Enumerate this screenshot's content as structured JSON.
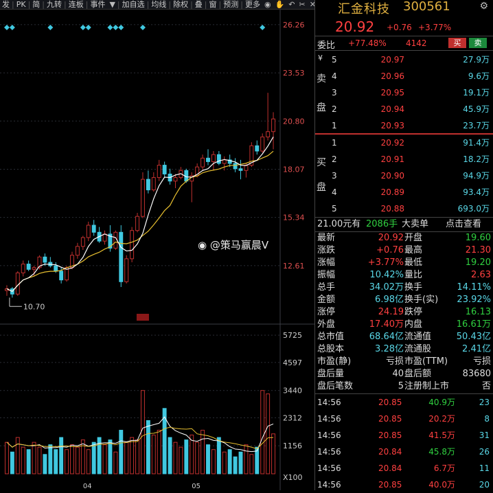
{
  "toolbar": {
    "items": [
      "发",
      "PK",
      "简",
      "九转",
      "连板",
      "事件"
    ],
    "dropdown_icon": "caret-down-icon",
    "items2": [
      "加自选",
      "均线",
      "除权",
      "叠",
      "窗",
      "预测",
      "更多"
    ],
    "icons": [
      "eye-icon",
      "hand-icon",
      "undo-icon",
      "scissors-icon",
      "close-icon",
      "up-icon",
      "down-icon"
    ]
  },
  "chart": {
    "price_axis": [
      "26.26",
      "23.53",
      "20.80",
      "18.07",
      "15.34",
      "12.61"
    ],
    "low_marker": "10.70",
    "vol_axis": [
      "5725",
      "4597",
      "3440",
      "2312",
      "1156"
    ],
    "vol_scale": "X100",
    "months": [
      "04",
      "05"
    ],
    "colors": {
      "up": "#c0302e",
      "down": "#40c8e0",
      "ma5": "#ffffff",
      "ma10": "#e8c030",
      "diamond": "#40c8e0",
      "grid": "#2a2d35"
    }
  },
  "chart_data": {
    "type": "candlestick",
    "candles": [
      [
        11.2,
        11.5,
        10.9,
        11.3
      ],
      [
        11.3,
        11.4,
        10.8,
        11.0
      ],
      [
        11.0,
        12.3,
        10.9,
        12.2
      ],
      [
        12.2,
        12.9,
        12.0,
        12.7
      ],
      [
        12.7,
        12.9,
        12.3,
        12.4
      ],
      [
        12.4,
        12.6,
        12.0,
        12.5
      ],
      [
        12.5,
        13.2,
        12.4,
        13.1
      ],
      [
        13.1,
        13.3,
        12.6,
        12.8
      ],
      [
        12.8,
        13.1,
        12.5,
        12.6
      ],
      [
        12.6,
        12.8,
        12.2,
        12.3
      ],
      [
        12.3,
        12.5,
        11.6,
        11.8
      ],
      [
        11.8,
        12.6,
        11.7,
        12.5
      ],
      [
        12.5,
        13.4,
        12.4,
        13.2
      ],
      [
        13.2,
        13.9,
        13.0,
        13.7
      ],
      [
        13.7,
        14.3,
        13.5,
        14.2
      ],
      [
        14.2,
        15.1,
        14.0,
        14.9
      ],
      [
        14.9,
        15.2,
        14.3,
        14.5
      ],
      [
        14.5,
        14.8,
        13.9,
        14.0
      ],
      [
        14.0,
        14.6,
        13.8,
        14.4
      ],
      [
        14.4,
        14.9,
        13.4,
        13.6
      ],
      [
        13.6,
        14.6,
        13.5,
        14.5
      ],
      [
        14.5,
        14.9,
        11.4,
        11.7
      ],
      [
        11.7,
        13.2,
        11.6,
        13.0
      ],
      [
        13.0,
        14.8,
        12.8,
        14.6
      ],
      [
        14.6,
        15.6,
        14.5,
        15.4
      ],
      [
        15.4,
        17.9,
        15.3,
        17.5
      ],
      [
        17.5,
        18.0,
        16.7,
        16.9
      ],
      [
        16.9,
        17.9,
        16.8,
        17.6
      ],
      [
        17.6,
        18.6,
        17.4,
        18.3
      ],
      [
        18.3,
        18.5,
        17.6,
        17.8
      ],
      [
        17.8,
        18.1,
        17.2,
        17.4
      ],
      [
        17.4,
        17.8,
        17.0,
        17.6
      ],
      [
        17.6,
        18.2,
        17.5,
        18.0
      ],
      [
        18.0,
        18.1,
        17.3,
        17.4
      ],
      [
        17.4,
        17.9,
        16.2,
        17.7
      ],
      [
        17.7,
        18.4,
        17.6,
        18.2
      ],
      [
        18.2,
        18.9,
        18.0,
        18.7
      ],
      [
        18.7,
        19.2,
        18.3,
        18.5
      ],
      [
        18.5,
        19.1,
        18.0,
        18.9
      ],
      [
        18.9,
        19.1,
        18.3,
        18.4
      ],
      [
        18.4,
        18.8,
        18.0,
        18.6
      ],
      [
        18.6,
        18.9,
        18.2,
        18.4
      ],
      [
        18.4,
        18.7,
        17.9,
        18.1
      ],
      [
        18.1,
        18.6,
        17.5,
        18.0
      ],
      [
        18.0,
        18.4,
        17.6,
        18.3
      ],
      [
        18.3,
        19.6,
        18.2,
        19.4
      ],
      [
        19.4,
        19.7,
        18.9,
        19.1
      ],
      [
        19.1,
        20.1,
        19.0,
        19.9
      ],
      [
        19.9,
        22.4,
        19.7,
        20.2
      ],
      [
        20.2,
        21.3,
        19.2,
        20.92
      ]
    ],
    "volumes": [
      1300,
      900,
      1500,
      1100,
      1000,
      1300,
      1100,
      800,
      1200,
      1000,
      1500,
      1000,
      1200,
      1100,
      1400,
      1000,
      1300,
      1500,
      1200,
      1400,
      900,
      1800,
      1300,
      1500,
      1400,
      3440,
      2200,
      1600,
      1800,
      2700,
      1500,
      1300,
      1100,
      1400,
      1600,
      1300,
      1800,
      1200,
      1000,
      1500,
      900,
      1000,
      700,
      900,
      1200,
      800,
      1100,
      3440,
      3300,
      1650
    ]
  },
  "panel": {
    "name": "汇金科技",
    "code": "300561",
    "settings_icon": "gear-icon",
    "price": "20.92",
    "change": "+0.76",
    "change_pct": "+3.77%",
    "weibi_label": "委比",
    "weibi_value": "+77.48%",
    "weicha": "4142",
    "buy_btn": "买",
    "sell_btn": "卖",
    "yen": "¥",
    "sell_side": [
      "卖",
      "盘"
    ],
    "buy_side": [
      "买",
      "盘"
    ],
    "sell": [
      {
        "lvl": "5",
        "price": "20.97",
        "vol": "27.9万"
      },
      {
        "lvl": "4",
        "price": "20.96",
        "vol": "9.6万"
      },
      {
        "lvl": "3",
        "price": "20.95",
        "vol": "19.1万"
      },
      {
        "lvl": "2",
        "price": "20.94",
        "vol": "45.9万"
      },
      {
        "lvl": "1",
        "price": "20.93",
        "vol": "23.7万"
      }
    ],
    "buy": [
      {
        "lvl": "1",
        "price": "20.92",
        "vol": "91.4万"
      },
      {
        "lvl": "2",
        "price": "20.91",
        "vol": "18.2万"
      },
      {
        "lvl": "3",
        "price": "20.90",
        "vol": "94.9万"
      },
      {
        "lvl": "4",
        "price": "20.89",
        "vol": "93.4万"
      },
      {
        "lvl": "5",
        "price": "20.88",
        "vol": "693.0万"
      }
    ],
    "bigorder": {
      "price": "21.00元有",
      "qty": "2086手",
      "label": "大卖单",
      "link": "点击查看"
    },
    "stats": [
      [
        "最新",
        "20.92",
        "red",
        "开盘",
        "19.60",
        "green"
      ],
      [
        "涨跌",
        "+0.76",
        "red",
        "最高",
        "21.30",
        "red"
      ],
      [
        "涨幅",
        "+3.77%",
        "red",
        "最低",
        "19.20",
        "green"
      ],
      [
        "振幅",
        "10.42%",
        "cyan",
        "量比",
        "2.63",
        "red"
      ],
      [
        "总手",
        "34.02万",
        "cyan",
        "换手",
        "14.11%",
        "cyan"
      ],
      [
        "金额",
        "6.98亿",
        "cyan",
        "换手(实)",
        "23.92%",
        "cyan"
      ],
      [
        "涨停",
        "24.19",
        "red",
        "跌停",
        "16.13",
        "green"
      ],
      [
        "外盘",
        "17.40万",
        "red",
        "内盘",
        "16.61万",
        "green"
      ],
      [
        "总市值",
        "68.64亿",
        "cyan",
        "流通值",
        "50.43亿",
        "cyan"
      ],
      [
        "总股本",
        "3.28亿",
        "cyan",
        "流通股",
        "2.41亿",
        "cyan"
      ],
      [
        "市盈(静)",
        "亏损",
        "white",
        "市盈(TTM)",
        "亏损",
        "white"
      ],
      [
        "盘后量",
        "40",
        "white",
        "盘后额",
        "83680",
        "white"
      ],
      [
        "盘后笔数",
        "5",
        "white",
        "注册制上市",
        "否",
        "white"
      ]
    ],
    "ticks": [
      [
        "14:56",
        "20.85",
        "40.9万",
        "green",
        "23"
      ],
      [
        "14:56",
        "20.85",
        "20.2万",
        "red",
        "8"
      ],
      [
        "14:56",
        "20.85",
        "41.5万",
        "red",
        "31"
      ],
      [
        "14:56",
        "20.84",
        "45.8万",
        "green",
        "26"
      ],
      [
        "14:56",
        "20.84",
        "6.7万",
        "red",
        "11"
      ],
      [
        "14:56",
        "20.85",
        "40.0万",
        "red",
        "20"
      ]
    ]
  },
  "watermark": "@策马赢晨V"
}
